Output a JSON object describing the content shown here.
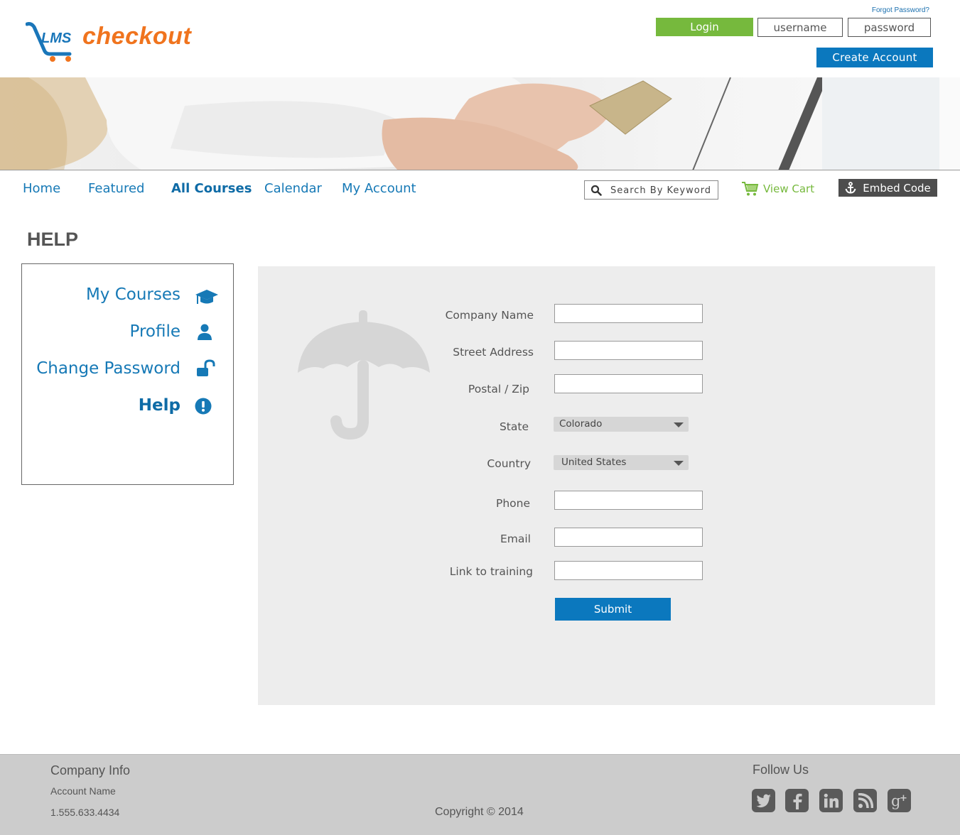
{
  "header": {
    "logo_text": "checkout",
    "logo_mark": "LMS",
    "forgot_password": "Forgot Password?",
    "login_label": "Login",
    "username_placeholder": "username",
    "password_placeholder": "password",
    "create_account_label": "Create  Account"
  },
  "nav": {
    "items": [
      {
        "label": "Home",
        "active": false
      },
      {
        "label": "Featured",
        "active": false
      },
      {
        "label": "All Courses",
        "active": true
      },
      {
        "label": "Calendar",
        "active": false
      },
      {
        "label": "My Account",
        "active": false
      }
    ],
    "search_placeholder": "Search By Keyword",
    "view_cart_label": "View Cart",
    "embed_code_label": "Embed Code"
  },
  "page": {
    "title": "HELP"
  },
  "sidebar": {
    "items": [
      {
        "label": "My Courses",
        "icon": "graduation-cap-icon",
        "active": false
      },
      {
        "label": "Profile",
        "icon": "user-icon",
        "active": false
      },
      {
        "label": "Change Password",
        "icon": "unlock-icon",
        "active": false
      },
      {
        "label": "Help",
        "icon": "exclamation-circle-icon",
        "active": true
      }
    ]
  },
  "form": {
    "fields": {
      "company_name": {
        "label": "Company Name",
        "value": ""
      },
      "street_address": {
        "label": "Street Address",
        "value": ""
      },
      "postal_zip": {
        "label": "Postal / Zip",
        "value": ""
      },
      "state": {
        "label": "State",
        "value": "Colorado"
      },
      "country": {
        "label": "Country",
        "value": "United States"
      },
      "phone": {
        "label": "Phone",
        "value": ""
      },
      "email": {
        "label": "Email",
        "value": ""
      },
      "link_to_training": {
        "label": "Link to training",
        "value": ""
      }
    },
    "submit_label": "Submit"
  },
  "footer": {
    "company_info_heading": "Company Info",
    "account_name": "Account Name",
    "phone": "1.555.633.4434",
    "copyright": "Copyright © 2014",
    "follow_us": "Follow Us",
    "social": [
      "twitter-icon",
      "facebook-icon",
      "linkedin-icon",
      "rss-icon",
      "google-plus-icon"
    ]
  },
  "colors": {
    "brand_orange": "#f0741e",
    "primary_blue": "#0b78be",
    "login_green": "#76b93d",
    "nav_blue": "#1679b6",
    "panel_gray": "#ededed",
    "footer_gray": "#cccccc"
  }
}
